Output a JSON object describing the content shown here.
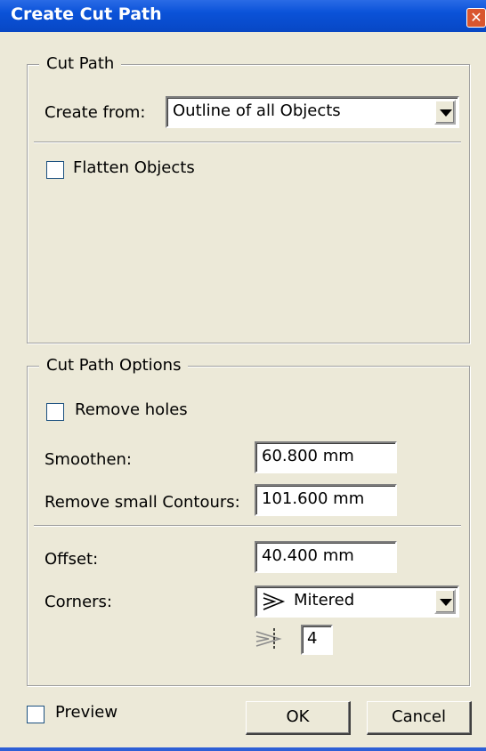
{
  "window": {
    "title": "Create Cut Path",
    "close_glyph": "✕"
  },
  "cut_path_group": {
    "legend": "Cut Path",
    "create_from_label": "Create from:",
    "create_from_value": "Outline of all Objects",
    "flatten_objects_label": "Flatten Objects",
    "flatten_objects_checked": false
  },
  "options_group": {
    "legend": "Cut Path Options",
    "remove_holes_label": "Remove holes",
    "remove_holes_checked": false,
    "smoothen_label": "Smoothen:",
    "smoothen_value": "60.800 mm",
    "remove_small_label": "Remove small Contours:",
    "remove_small_value": "101.600 mm",
    "offset_label": "Offset:",
    "offset_value": "40.400 mm",
    "corners_label": "Corners:",
    "corners_value": "Mitered",
    "corners_icon": "miter-corner-icon",
    "miter_limit_icon": "miter-limit-icon",
    "miter_limit_value": "4"
  },
  "footer": {
    "preview_label": "Preview",
    "preview_checked": false,
    "ok_label": "OK",
    "cancel_label": "Cancel"
  }
}
